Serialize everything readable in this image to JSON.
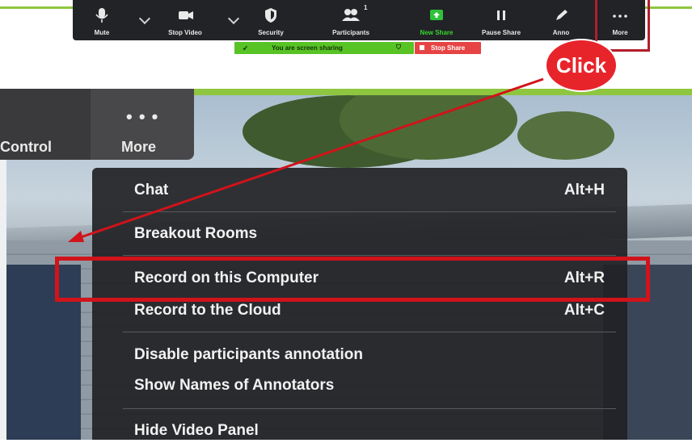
{
  "toolbar": {
    "items": [
      {
        "label": "Mute",
        "icon": "microphone-icon"
      },
      {
        "label": "Stop Video",
        "icon": "video-camera-icon"
      },
      {
        "label": "Security",
        "icon": "shield-icon"
      },
      {
        "label": "Participants",
        "icon": "participants-icon",
        "badge": "1"
      },
      {
        "label": "New Share",
        "icon": "share-up-arrow-icon"
      },
      {
        "label": "Pause Share",
        "icon": "pause-icon"
      },
      {
        "label": "Anno",
        "icon": "pencil-icon"
      },
      {
        "label": "More",
        "icon": "ellipsis-icon"
      }
    ],
    "share_banner": "You are screen sharing",
    "stop_share": "Stop Share"
  },
  "controls": {
    "left_label": "Control",
    "more_label": "More",
    "more_dots": "• • •"
  },
  "menu": {
    "items": [
      {
        "label": "Chat",
        "shortcut": "Alt+H"
      },
      {
        "label": "Breakout Rooms",
        "shortcut": ""
      },
      {
        "label": "Record on this Computer",
        "shortcut": "Alt+R"
      },
      {
        "label": "Record to the Cloud",
        "shortcut": "Alt+C"
      },
      {
        "label": "Disable participants annotation",
        "shortcut": ""
      },
      {
        "label": "Show Names of Annotators",
        "shortcut": ""
      },
      {
        "label": "Hide Video Panel",
        "shortcut": ""
      }
    ]
  },
  "annotation": {
    "click_label": "Click",
    "highlight_color": "#d1131a"
  },
  "colors": {
    "toolbar_bg": "#222326",
    "share_green": "#58c325",
    "stop_red": "#e64444",
    "menu_bg": "#222225"
  }
}
